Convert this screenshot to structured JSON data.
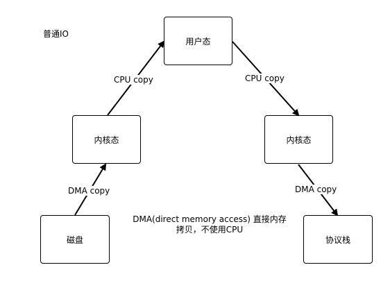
{
  "title": "普通IO",
  "nodes": {
    "user_space": "用户态",
    "kernel_left": "内核态",
    "kernel_right": "内核态",
    "disk": "磁盘",
    "protocol_stack": "协议栈"
  },
  "edges": {
    "disk_to_kernel": "DMA copy",
    "kernel_to_user": "CPU copy",
    "user_to_kernel": "CPU copy",
    "kernel_to_protocol": "DMA copy"
  },
  "note": {
    "line1": "DMA(direct memory access) 直接内存",
    "line2": "拷贝，不使用CPU"
  }
}
